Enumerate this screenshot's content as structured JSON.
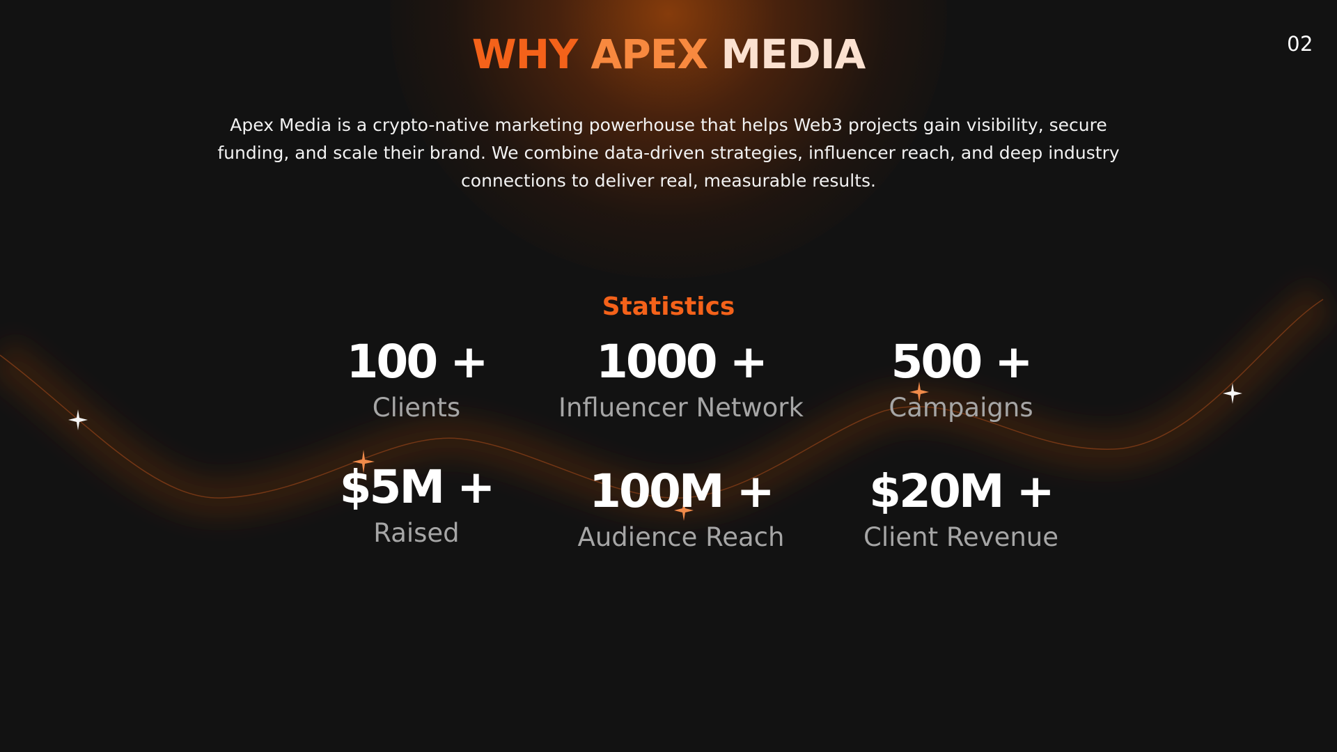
{
  "slide": {
    "page_number": "02",
    "title": {
      "part1": "WHY ",
      "part2": "APEX ",
      "part3": "MEDIA"
    },
    "description": "Apex Media is a crypto-native marketing powerhouse that helps Web3 projects gain visibility, secure funding, and scale their brand. We combine data-driven strategies, influencer reach, and deep industry connections to deliver real, measurable results.",
    "statistics_heading": "Statistics",
    "stats": [
      {
        "value": "100 +",
        "label": "Clients"
      },
      {
        "value": "1000 +",
        "label": "Influencer Network"
      },
      {
        "value": "500 +",
        "label": "Campaigns"
      },
      {
        "value": "$5M +",
        "label": "Raised"
      },
      {
        "value": "100M +",
        "label": "Audience Reach"
      },
      {
        "value": "$20M +",
        "label": "Client Revenue"
      }
    ]
  },
  "colors": {
    "background": "#121212",
    "accent_orange": "#f4621a",
    "light_orange": "#f8893f",
    "muted_label": "#a6a6a6"
  }
}
